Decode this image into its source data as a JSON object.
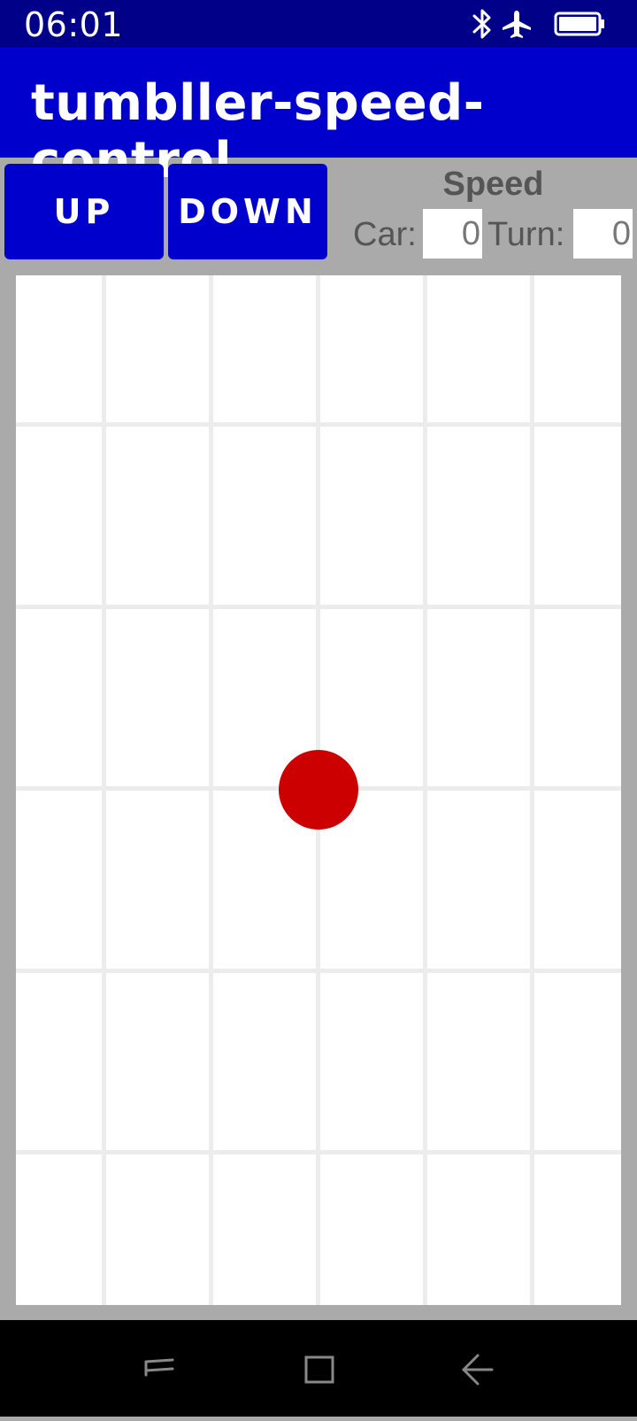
{
  "status": {
    "time": "06:01",
    "icons": [
      "bluetooth-icon",
      "airplane-mode-icon",
      "battery-icon"
    ]
  },
  "app": {
    "title": "tumbller-speed-control"
  },
  "controls": {
    "up_label": "UP",
    "down_label": "DOWN"
  },
  "speed": {
    "title": "Speed",
    "car_label": "Car:",
    "car_value": "0",
    "turn_label": "Turn:",
    "turn_value": "0"
  },
  "joystick": {
    "dot_color": "#cc0000"
  },
  "nav": {
    "icons": [
      "recents-icon",
      "home-icon",
      "back-icon"
    ]
  },
  "colors": {
    "status_bar": "#000088",
    "title_bar": "#0000cc",
    "button": "#0000cc",
    "background": "#aaaaaa"
  }
}
